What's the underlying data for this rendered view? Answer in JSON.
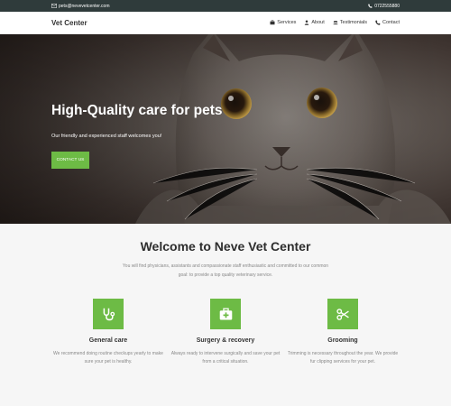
{
  "topbar": {
    "email": "pets@nevevetcenter.com",
    "phone": "0722555880"
  },
  "nav": {
    "brand": "Vet Center",
    "items": [
      {
        "label": "Services",
        "icon": "briefcase-icon"
      },
      {
        "label": "About",
        "icon": "person-icon"
      },
      {
        "label": "Testimonials",
        "icon": "users-icon"
      },
      {
        "label": "Contact",
        "icon": "phone-icon"
      }
    ]
  },
  "hero": {
    "title": "High-Quality care for pets",
    "subtitle": "Our friendly and experienced staff welcomes you!",
    "button": "CONTACT US"
  },
  "welcome": {
    "title": "Welcome to Neve Vet Center",
    "description": "You will find physicians, assistants and compassionate staff enthusiastic and committed to our common goal: to provide a top quality veterinary service."
  },
  "services": [
    {
      "title": "General care",
      "icon": "stethoscope-icon",
      "description": "We recommend doing routine checkups yearly to make sure your pet is healthy."
    },
    {
      "title": "Surgery & recovery",
      "icon": "medkit-icon",
      "description": "Always ready to intervene surgically and save your pet from a critical situation."
    },
    {
      "title": "Grooming",
      "icon": "scissors-icon",
      "description": "Trimming is necessary throughout the year. We provide fur clipping services for your pet."
    }
  ],
  "colors": {
    "accent": "#6dbb45",
    "topbar": "#2f3b3b"
  }
}
